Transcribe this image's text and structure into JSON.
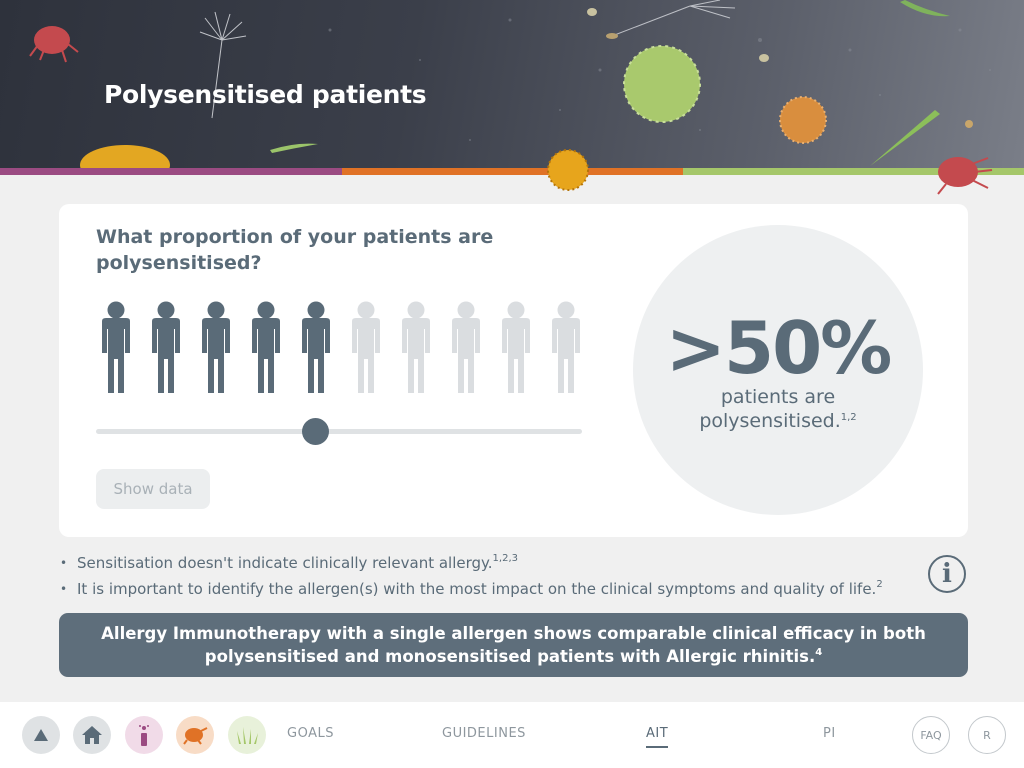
{
  "header": {
    "title": "Polysensitised patients"
  },
  "card": {
    "question": "What proportion of your patients are polysensitised?",
    "people_total": 10,
    "people_highlighted": 5,
    "slider_value_fraction": 0.45,
    "show_data_label": "Show data",
    "big_value": ">50%",
    "caption_line1": "patients are",
    "caption_line2": "polysensitised.",
    "caption_refs": "1,2",
    "colors": {
      "active": "#5a6b78",
      "inactive": "#dadde0"
    }
  },
  "bullets": [
    {
      "text": "Sensitisation doesn't indicate clinically relevant allergy.",
      "refs": "1,2,3"
    },
    {
      "text": "It is important to identify the allergen(s) with the most impact on the clinical symptoms and quality of life.",
      "refs": "2"
    }
  ],
  "info_icon": "i",
  "banner": {
    "line1": "Allergy Immunotherapy with a single allergen shows comparable clinical efficacy in both",
    "line2": "polysensitised and monosensitised patients with Allergic rhinitis.",
    "refs": "4"
  },
  "footer": {
    "icons": [
      "up-arrow-icon",
      "home-icon",
      "tree-pollen-icon",
      "dust-mite-icon",
      "grass-icon"
    ],
    "links": [
      {
        "label": "GOALS",
        "active": false
      },
      {
        "label": "GUIDELINES",
        "active": false
      },
      {
        "label": "AIT",
        "active": true
      },
      {
        "label": "PI",
        "active": false
      }
    ],
    "faq_label": "FAQ",
    "r_label": "R"
  },
  "theme_colors": {
    "purple": "#9b4b82",
    "orange": "#e07226",
    "green": "#a5c76a",
    "slate": "#5a6b78"
  }
}
